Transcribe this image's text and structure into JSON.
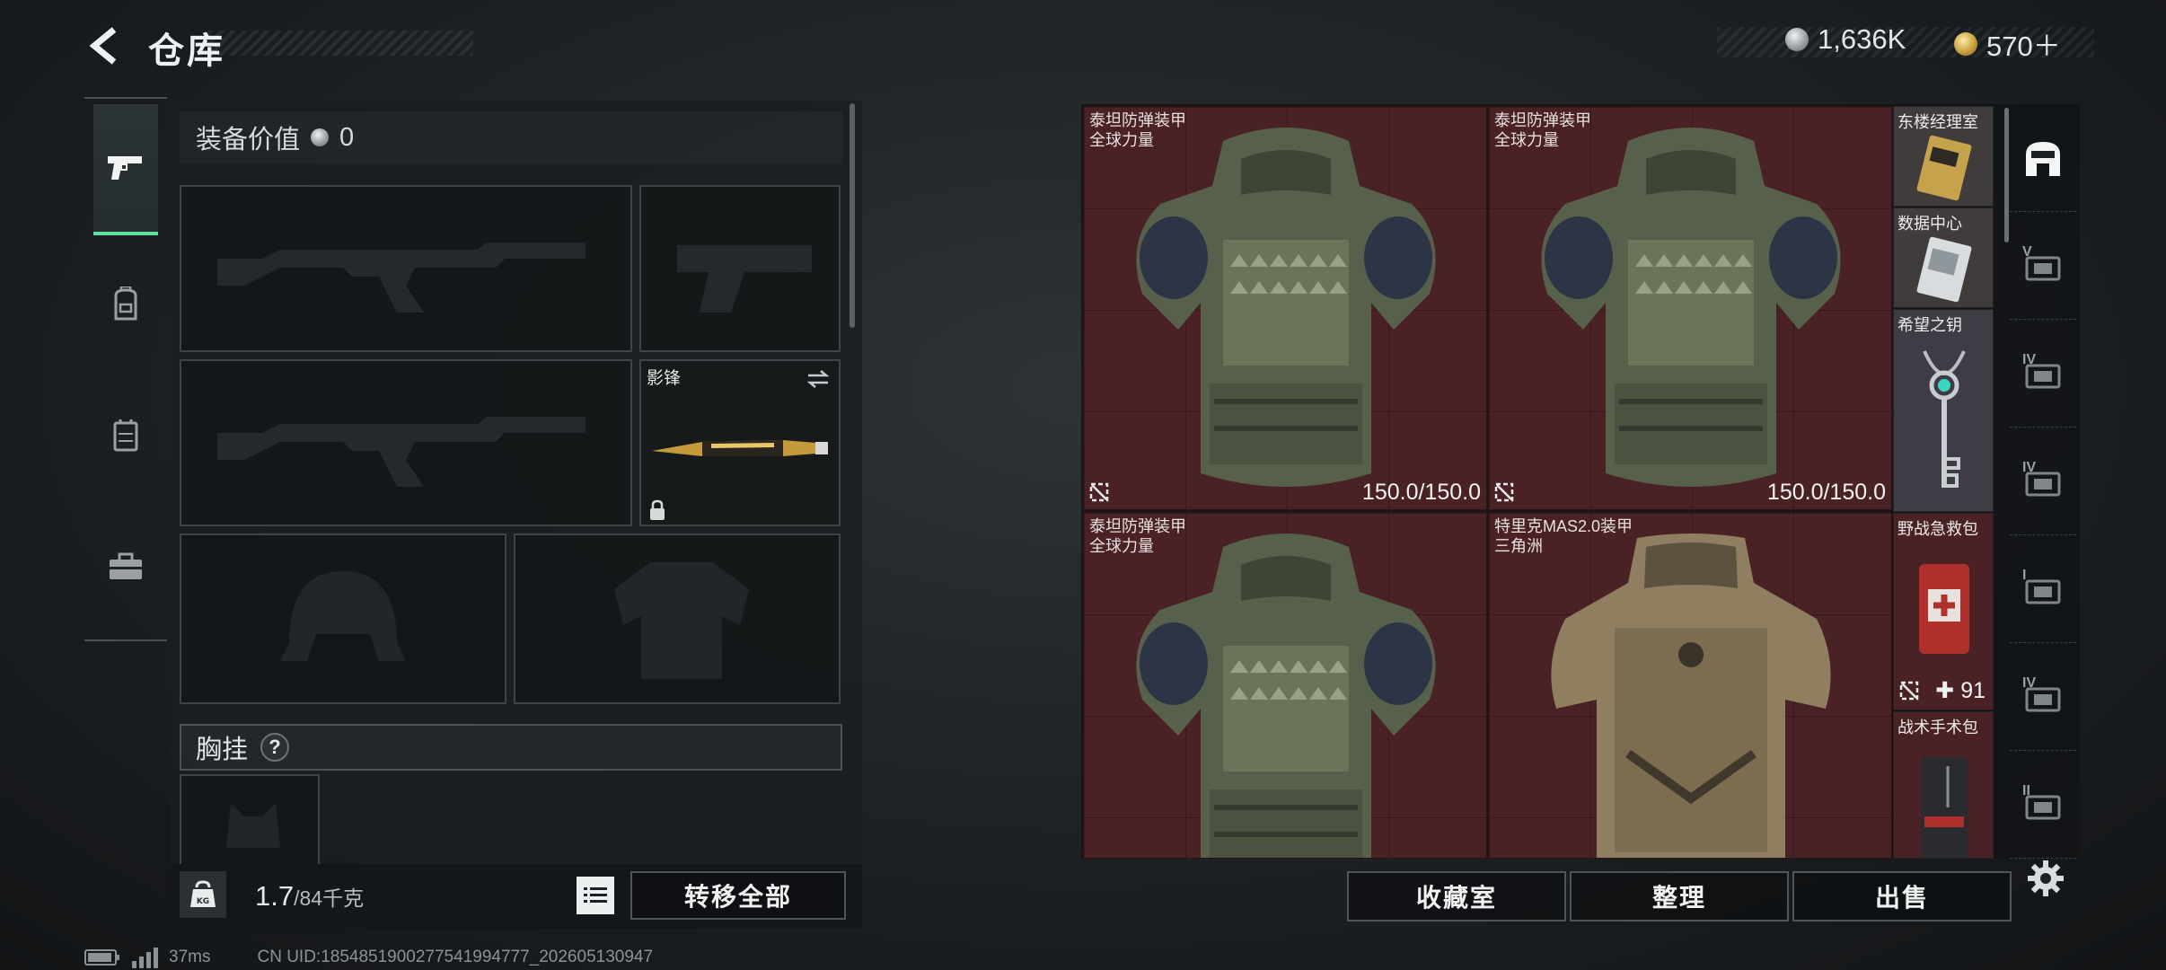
{
  "header": {
    "title": "仓库",
    "currencies": [
      {
        "name": "silver-coin",
        "value": "1,636K"
      },
      {
        "name": "gold-coin",
        "value": "570＋"
      }
    ]
  },
  "left_rail": {
    "items": [
      {
        "icon": "pistol-icon",
        "active": true
      },
      {
        "icon": "backpack-icon",
        "active": false
      },
      {
        "icon": "vest-icon",
        "active": false
      },
      {
        "icon": "toolbox-icon",
        "active": false
      }
    ]
  },
  "loadout": {
    "equip_value_label": "装备价值",
    "equip_value": "0",
    "melee_slot": {
      "name": "影锋"
    },
    "chest_rig_label": "胸挂",
    "chest_rig_help": "?",
    "weight_value": "1.7",
    "weight_max": "/84千克",
    "transfer_all_label": "转移全部"
  },
  "stash": {
    "armor_items": [
      {
        "name1": "泰坦防弹装甲",
        "name2": "全球力量",
        "durability": "150.0/150.0",
        "variant": "titan"
      },
      {
        "name1": "泰坦防弹装甲",
        "name2": "全球力量",
        "durability": "150.0/150.0",
        "variant": "titan"
      },
      {
        "name1": "泰坦防弹装甲",
        "name2": "全球力量",
        "durability": "",
        "variant": "titan"
      },
      {
        "name1": "特里克MAS2.0装甲",
        "name2": "三角洲",
        "durability": "",
        "variant": "mas"
      }
    ],
    "small_items": [
      {
        "name": "东楼经理室"
      },
      {
        "name": "数据中心"
      },
      {
        "name": "希望之钥"
      },
      {
        "name": "野战急救包",
        "count": "✚ 91"
      },
      {
        "name": "战术手术包"
      }
    ],
    "buttons": {
      "collection": "收藏室",
      "sort": "整理",
      "sell": "出售"
    }
  },
  "right_tabs": [
    {
      "icon": "home-icon",
      "roman": ""
    },
    {
      "icon": "storage-v-icon",
      "roman": "V"
    },
    {
      "icon": "storage-iv-icon",
      "roman": "IV"
    },
    {
      "icon": "storage-iv-plus-icon",
      "roman": "IV"
    },
    {
      "icon": "storage-i-icon",
      "roman": "I"
    },
    {
      "icon": "storage-iv-b-icon",
      "roman": "IV"
    },
    {
      "icon": "storage-ii-icon",
      "roman": "II"
    }
  ],
  "footer": {
    "ping": "37ms",
    "uid": "CN UID:1854851900277541994777_202605130947"
  },
  "colors": {
    "accent": "#5ee0a0",
    "armor_cell": "#4a2124",
    "panel": "#1a1e21"
  }
}
